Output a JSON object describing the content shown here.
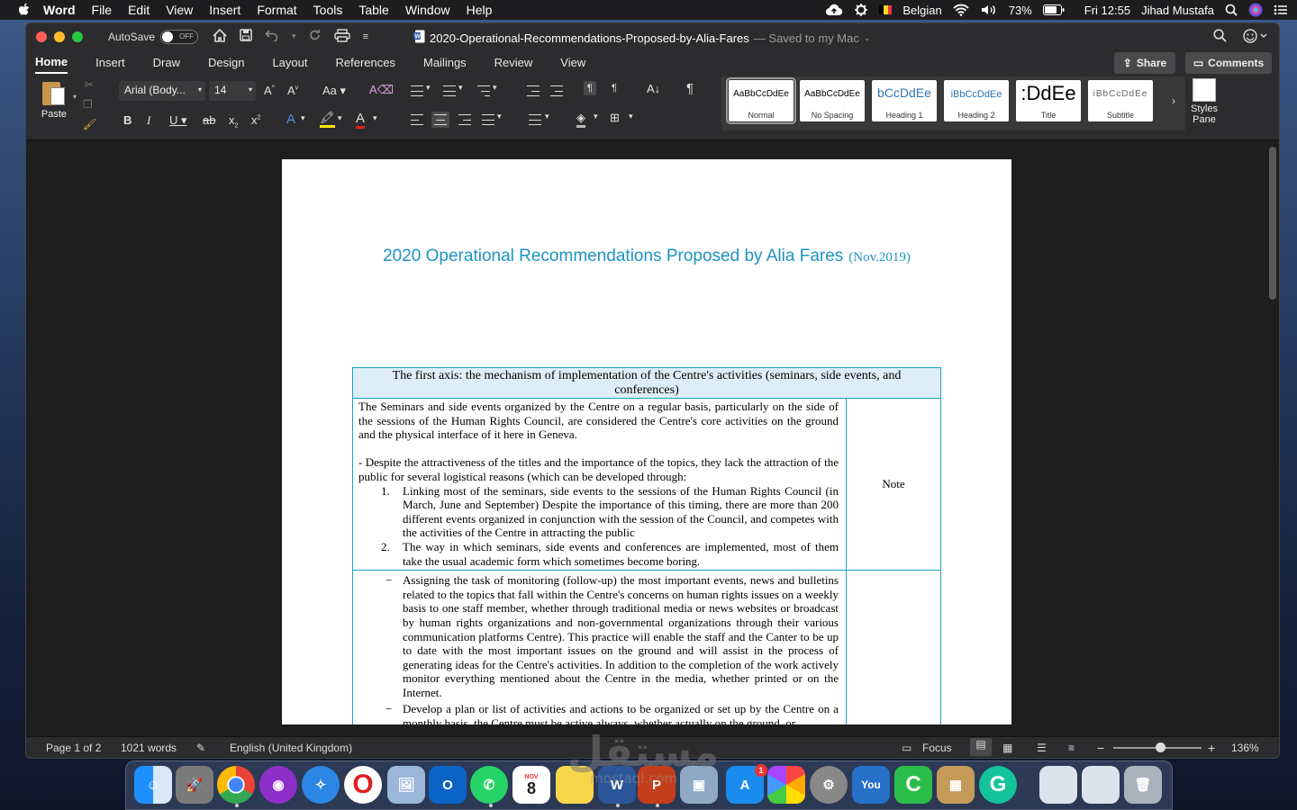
{
  "menubar": {
    "app": "Word",
    "items": [
      "File",
      "Edit",
      "View",
      "Insert",
      "Format",
      "Tools",
      "Table",
      "Window",
      "Help"
    ],
    "keyboard": "Belgian",
    "battery": "73%",
    "clock": "Fri 12:55",
    "user": "Jihad Mustafa"
  },
  "window": {
    "autosave_label": "AutoSave",
    "autosave_state": "OFF",
    "doc_name": "2020-Operational-Recommendations-Proposed-by-Alia-Fares",
    "saved_status": "— Saved to my Mac"
  },
  "ribbon": {
    "tabs": [
      "Home",
      "Insert",
      "Draw",
      "Design",
      "Layout",
      "References",
      "Mailings",
      "Review",
      "View"
    ],
    "share_label": "Share",
    "comments_label": "Comments",
    "paste_label": "Paste",
    "font_name": "Arial (Body...",
    "font_size": "14",
    "styles": [
      {
        "preview": "AaBbCcDdEe",
        "name": "Normal"
      },
      {
        "preview": "AaBbCcDdEe",
        "name": "No Spacing"
      },
      {
        "preview": "bCcDdEe",
        "name": "Heading 1"
      },
      {
        "preview": "iBbCcDdEe",
        "name": "Heading 2"
      },
      {
        "preview": ":DdEe",
        "name": "Title"
      },
      {
        "preview": "iBbCcDdEe",
        "name": "Subtitle"
      }
    ],
    "styles_pane_label": "Styles Pane"
  },
  "document": {
    "title": "2020 Operational Recommendations Proposed by Alia Fares",
    "date": "(Nov.2019)",
    "table": {
      "header": "The first axis: the mechanism of implementation of the  Centre's activities (seminars, side events, and conferences)",
      "row1": {
        "para1": "The Seminars and side events organized by the Centre on a regular basis, particularly on the side of the sessions of the Human Rights Council, are considered the Centre's core activities on the ground and the physical interface of it here in Geneva.",
        "para2": " - Despite the attractiveness of the titles and the importance of the topics, they lack the attraction of the public for several logistical reasons (which can be developed through:",
        "items": [
          {
            "num": "1.",
            "text": "Linking most of the seminars, side events to the sessions of the Human Rights Council (in March, June and September) Despite the importance of this timing, there are more than 200 different events organized in conjunction with the session of the Council, and competes with the activities of the Centre in attracting the public"
          },
          {
            "num": "2.",
            "text": "The way in which seminars, side events and conferences are implemented, most of them take the usual academic form which sometimes become boring."
          }
        ],
        "note": "Note"
      },
      "row2": {
        "items": [
          {
            "num": "−",
            "text": "Assigning the task of monitoring (follow-up) the most important events, news and bulletins related to the topics that fall within the  Centre's concerns on human rights issues on a weekly basis to one staff member, whether through traditional media or news websites or broadcast by human rights organizations and non-governmental organizations through their various communication platforms  Centre). This practice will enable the staff and the Canter to be up to date with the most important issues on the ground and will assist in the process of generating ideas for the Centre's activities. In addition to the completion of the work actively monitor everything mentioned about the Centre in the media, whether printed or on the Internet."
          },
          {
            "num": "−",
            "text": "Develop a plan or list of activities and actions to be organized or set up by the Centre on a monthly basis, the Centre must be active always, whether actually on the ground, or"
          }
        ]
      }
    }
  },
  "status": {
    "page": "Page 1 of 2",
    "words": "1021 words",
    "language": "English (United Kingdom)",
    "focus": "Focus",
    "zoom": "136%"
  },
  "dock": {
    "calendar_month": "NOV",
    "calendar_day": "8",
    "appstore_badge": "1"
  },
  "watermark": {
    "text": "مستقل",
    "sub": "mostaql.com"
  }
}
